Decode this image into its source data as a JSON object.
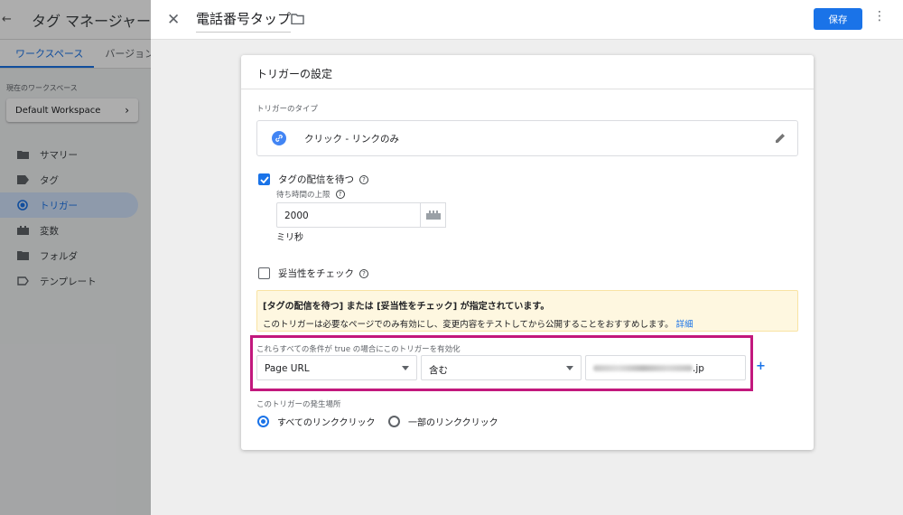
{
  "sidebar": {
    "app_title": "タグ マネージャー",
    "tabs": [
      {
        "label": "ワークスペース"
      },
      {
        "label": "バージョン"
      }
    ],
    "workspace_label": "現在のワークスペース",
    "workspace_name": "Default Workspace",
    "nav": [
      {
        "label": "サマリー"
      },
      {
        "label": "タグ"
      },
      {
        "label": "トリガー"
      },
      {
        "label": "変数"
      },
      {
        "label": "フォルダ"
      },
      {
        "label": "テンプレート"
      }
    ]
  },
  "header": {
    "title": "電話番号タップ",
    "save_label": "保存"
  },
  "trigger": {
    "section_title": "トリガーの設定",
    "type_label": "トリガーのタイプ",
    "type_value": "クリック - リンクのみ",
    "wait_tags_label": "タグの配信を待つ",
    "wait_tags_checked": true,
    "max_wait_label": "待ち時間の上限",
    "max_wait_value": "2000",
    "ms_label": "ミリ秒",
    "check_validation_label": "妥当性をチェック",
    "check_validation_checked": false,
    "notice_title": "[タグの配信を待つ] または [妥当性をチェック] が指定されています。",
    "notice_body": "このトリガーは必要なページでのみ有効にし、変更内容をテストしてから公開することをおすすめします。",
    "notice_link": "詳細",
    "condition_label": "これらすべての条件が true の場合にこのトリガーを有効化",
    "condition_variable": "Page URL",
    "condition_operator": "含む",
    "condition_value_suffix": ".jp",
    "fire_on_label": "このトリガーの発生場所",
    "fire_all": "すべてのリンククリック",
    "fire_some": "一部のリンククリック"
  },
  "colors": {
    "accent": "#1a73e8",
    "highlight": "#c2187d",
    "notice_bg": "#fef7e0"
  }
}
